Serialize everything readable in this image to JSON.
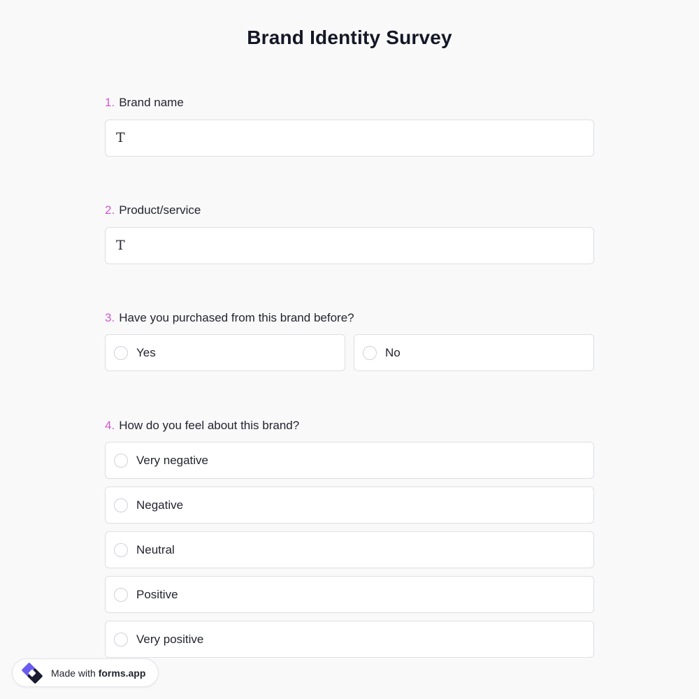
{
  "survey": {
    "title": "Brand Identity Survey"
  },
  "questions": [
    {
      "number": "1.",
      "label": "Brand name",
      "input_icon": "text-type-icon",
      "input_glyph": "T"
    },
    {
      "number": "2.",
      "label": "Product/service",
      "input_icon": "text-type-icon",
      "input_glyph": "T"
    },
    {
      "number": "3.",
      "label": "Have you purchased from this brand before?",
      "options": [
        "Yes",
        "No"
      ]
    },
    {
      "number": "4.",
      "label": "How do you feel about this brand?",
      "options": [
        "Very negative",
        "Negative",
        "Neutral",
        "Positive",
        "Very positive"
      ]
    }
  ],
  "badge": {
    "prefix": "Made with",
    "brand": "forms.app",
    "logo_icon": "forms-app-logo-icon"
  },
  "colors": {
    "accent": "#d457d0",
    "background": "#f9f9fa",
    "logo_primary": "#6b5cf0",
    "logo_dark": "#1b1a33"
  }
}
